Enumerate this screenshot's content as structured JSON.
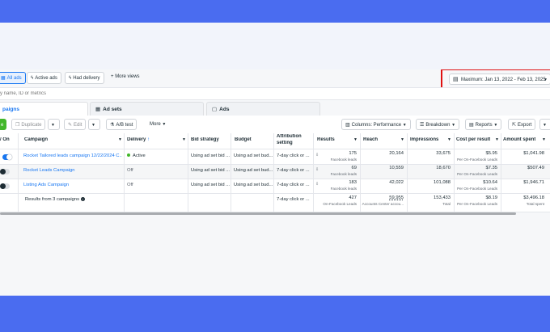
{
  "filters": {
    "all_ads": "All ads",
    "active_ads": "Active ads",
    "had_delivery": "Had delivery",
    "more_views": "More views",
    "date_range": "Maximum: Jan 13, 2022 - Feb 13, 2025"
  },
  "search": {
    "placeholder": "y name, ID or metrics"
  },
  "tabs": [
    {
      "label": "paigns"
    },
    {
      "label": "Ad sets"
    },
    {
      "label": "Ads"
    }
  ],
  "toolbar": {
    "create": "e",
    "duplicate": "Duplicate",
    "edit": "Edit",
    "ab_test": "A/B test",
    "more": "More",
    "columns": "Columns: Performance",
    "breakdown": "Breakdown",
    "reports": "Reports",
    "export": "Export"
  },
  "columns": {
    "onoff": "/ On",
    "campaign": "Campaign",
    "delivery": "Delivery",
    "bid_strategy": "Bid strategy",
    "budget": "Budget",
    "attribution_1": "Attribution",
    "attribution_2": "setting",
    "results": "Results",
    "reach": "Reach",
    "impressions": "Impressions",
    "cost_per_result": "Cost per result",
    "amount_spent": "Amount spent"
  },
  "rows": [
    {
      "on": true,
      "campaign": "Rocket Tailored leads campaign 12/22/2024 C...",
      "delivery": "Active",
      "bid": "Using ad set bid ...",
      "budget": "Using ad set bud...",
      "attribution": "7-day click or ...",
      "results": "175",
      "results_sub": "Facebook leads",
      "reach": "20,164",
      "impressions": "33,675",
      "cpr": "$5.95",
      "cpr_sub": "Per On-Facebook Leads",
      "spent": "$1,041.98"
    },
    {
      "on": false,
      "campaign": "Rocket Leads Campaign",
      "delivery": "Off",
      "bid": "Using ad set bid ...",
      "budget": "Using ad set bud...",
      "attribution": "7-day click or ...",
      "results": "69",
      "results_sub": "Facebook leads",
      "reach": "10,559",
      "impressions": "18,670",
      "cpr": "$7.35",
      "cpr_sub": "Per On-Facebook Leads",
      "spent": "$507.49"
    },
    {
      "on": false,
      "campaign": "Listing Ads Campaign",
      "delivery": "Off",
      "bid": "Using ad set bid ...",
      "budget": "Using ad set bud...",
      "attribution": "7-day click or ...",
      "results": "183",
      "results_sub": "Facebook leads",
      "reach": "42,022",
      "impressions": "101,088",
      "cpr": "$10.64",
      "cpr_sub": "Per On-Facebook Leads",
      "spent": "$1,946.71"
    }
  ],
  "totals": {
    "label": "Results from 3 campaigns",
    "attribution": "7-day click or ...",
    "results": "427",
    "results_sub": "On-Facebook Leads",
    "reach": "59,955",
    "reach_sub": "Accounts Center accou...",
    "impressions": "153,433",
    "impressions_sub": "Total",
    "cpr": "$8.19",
    "cpr_sub": "Per On-Facebook Leads",
    "spent": "$3,496.18",
    "spent_sub": "Total spent"
  },
  "colors": {
    "accent": "#1877f2",
    "band": "#4a6cf0",
    "highlight": "#e01010",
    "active_dot": "#42b72a"
  }
}
